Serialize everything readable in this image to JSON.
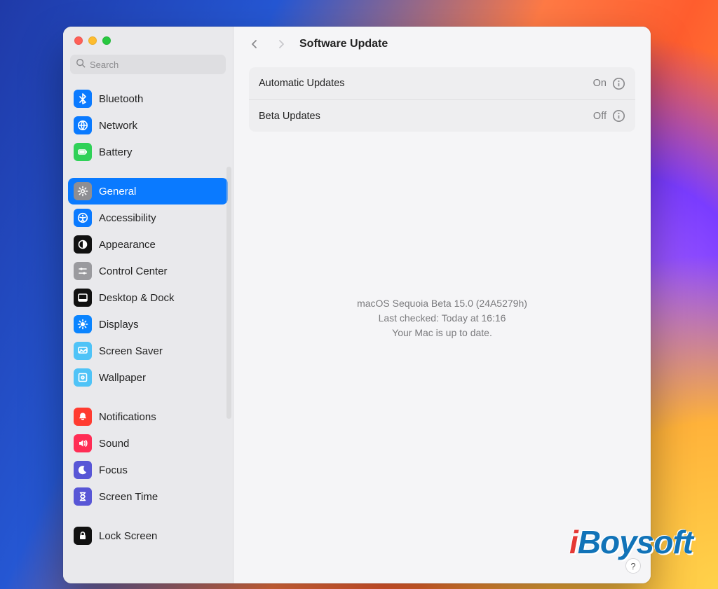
{
  "search": {
    "placeholder": "Search"
  },
  "header": {
    "title": "Software Update"
  },
  "sidebar": {
    "groups": [
      {
        "items": [
          {
            "id": "bluetooth",
            "label": "Bluetooth",
            "icon": "bluetooth",
            "icon_bg": "#0a7aff",
            "icon_fg": "#ffffff"
          },
          {
            "id": "network",
            "label": "Network",
            "icon": "globe",
            "icon_bg": "#0a7aff",
            "icon_fg": "#ffffff"
          },
          {
            "id": "battery",
            "label": "Battery",
            "icon": "battery",
            "icon_bg": "#30d158",
            "icon_fg": "#ffffff"
          }
        ]
      },
      {
        "items": [
          {
            "id": "general",
            "label": "General",
            "icon": "gear",
            "icon_bg": "#8e8e93",
            "icon_fg": "#ffffff",
            "selected": true
          },
          {
            "id": "accessibility",
            "label": "Accessibility",
            "icon": "accessibility",
            "icon_bg": "#0a7aff",
            "icon_fg": "#ffffff"
          },
          {
            "id": "appearance",
            "label": "Appearance",
            "icon": "appearance",
            "icon_bg": "#111111",
            "icon_fg": "#ffffff"
          },
          {
            "id": "control-center",
            "label": "Control Center",
            "icon": "sliders",
            "icon_bg": "#9a9a9e",
            "icon_fg": "#ffffff"
          },
          {
            "id": "desktop-dock",
            "label": "Desktop & Dock",
            "icon": "dock",
            "icon_bg": "#111111",
            "icon_fg": "#ffffff"
          },
          {
            "id": "displays",
            "label": "Displays",
            "icon": "sun",
            "icon_bg": "#0a84ff",
            "icon_fg": "#ffffff"
          },
          {
            "id": "screen-saver",
            "label": "Screen Saver",
            "icon": "screensaver",
            "icon_bg": "#4fc3f7",
            "icon_fg": "#ffffff"
          },
          {
            "id": "wallpaper",
            "label": "Wallpaper",
            "icon": "wallpaper",
            "icon_bg": "#4fc3f7",
            "icon_fg": "#ffffff"
          }
        ]
      },
      {
        "items": [
          {
            "id": "notifications",
            "label": "Notifications",
            "icon": "bell",
            "icon_bg": "#ff3b30",
            "icon_fg": "#ffffff"
          },
          {
            "id": "sound",
            "label": "Sound",
            "icon": "speaker",
            "icon_bg": "#ff2d55",
            "icon_fg": "#ffffff"
          },
          {
            "id": "focus",
            "label": "Focus",
            "icon": "moon",
            "icon_bg": "#5856d6",
            "icon_fg": "#ffffff"
          },
          {
            "id": "screen-time",
            "label": "Screen Time",
            "icon": "hourglass",
            "icon_bg": "#5856d6",
            "icon_fg": "#ffffff"
          }
        ]
      },
      {
        "items": [
          {
            "id": "lock-screen",
            "label": "Lock Screen",
            "icon": "lock",
            "icon_bg": "#111111",
            "icon_fg": "#ffffff"
          }
        ]
      }
    ]
  },
  "settings": {
    "rows": [
      {
        "id": "automatic-updates",
        "label": "Automatic Updates",
        "value": "On"
      },
      {
        "id": "beta-updates",
        "label": "Beta Updates",
        "value": "Off"
      }
    ]
  },
  "status": {
    "line1": "macOS Sequoia Beta 15.0 (24A5279h)",
    "line2": "Last checked: Today at 16:16",
    "line3": "Your Mac is up to date."
  },
  "help_label": "?",
  "watermark": {
    "prefix": "i",
    "rest": "Boysoft"
  }
}
